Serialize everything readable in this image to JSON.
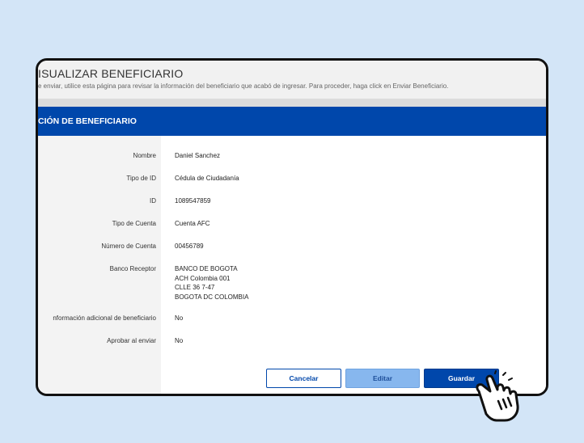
{
  "page": {
    "title": "ISUALIZAR BENEFICIARIO",
    "subtitle": "e enviar, utilice esta página para revisar la información del beneficiario que acabó de ingresar. Para proceder, haga click en Enviar Beneficiario."
  },
  "section": {
    "title": "CIÓN DE BENEFICIARIO"
  },
  "fields": [
    {
      "label": "Nombre",
      "value": "Daniel Sanchez"
    },
    {
      "label": "Tipo de ID",
      "value": "Cédula de Ciudadanía"
    },
    {
      "label": "ID",
      "value": "1089547859"
    },
    {
      "label": "Tipo de Cuenta",
      "value": "Cuenta AFC"
    },
    {
      "label": "Número de Cuenta",
      "value": "00456789"
    },
    {
      "label": "Banco Receptor",
      "value_lines": [
        "BANCO DE BOGOTA",
        "ACH Colombia 001",
        "CLLE 36 7-47",
        "BOGOTA DC COLOMBIA"
      ]
    },
    {
      "label": "nformación adicional de beneficiario",
      "value": "No"
    },
    {
      "label": "Aprobar al enviar",
      "value": "No"
    }
  ],
  "buttons": {
    "cancel": "Cancelar",
    "edit": "Editar",
    "save": "Guardar"
  },
  "icons": {
    "pointer": "hand-pointer-icon"
  },
  "colors": {
    "primary": "#0047ab",
    "edit_button": "#87b7ee",
    "background": "#d3e5f7"
  }
}
